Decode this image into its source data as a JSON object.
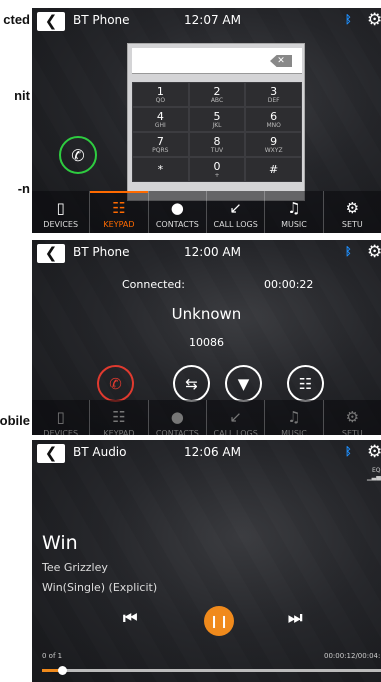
{
  "doc_fragments": [
    "cted",
    "nit",
    "n-",
    "obile"
  ],
  "nav": [
    "DEVICES",
    "KEYPAD",
    "CONTACTS",
    "CALL LOGS",
    "MUSIC",
    "SETU"
  ],
  "nav_icons": [
    "phone-device-icon",
    "keypad-grid-icon",
    "person-icon",
    "call-log-arrow-icon",
    "music-note-icon",
    "gear-icon"
  ],
  "screen1": {
    "title": "BT Phone",
    "time": "12:07 AM",
    "keys": [
      {
        "digit": "1",
        "letters": "QO"
      },
      {
        "digit": "2",
        "letters": "ABC"
      },
      {
        "digit": "3",
        "letters": "DEF"
      },
      {
        "digit": "4",
        "letters": "GHI"
      },
      {
        "digit": "5",
        "letters": "JKL"
      },
      {
        "digit": "6",
        "letters": "MNO"
      },
      {
        "digit": "7",
        "letters": "PQRS"
      },
      {
        "digit": "8",
        "letters": "TUV"
      },
      {
        "digit": "9",
        "letters": "WXYZ"
      },
      {
        "digit": "*",
        "letters": ""
      },
      {
        "digit": "0",
        "letters": "+"
      },
      {
        "digit": "#",
        "letters": ""
      }
    ]
  },
  "screen2": {
    "title": "BT Phone",
    "time": "12:00 AM",
    "status": "Connected:",
    "duration": "00:00:22",
    "caller": "Unknown",
    "number": "10086"
  },
  "screen3": {
    "title": "BT Audio",
    "time": "12:06 AM",
    "eq_label": "EQ",
    "song": "Win",
    "artist": "Tee Grizzley",
    "album": "Win(Single) (Explicit)",
    "track_pos": "0 of 1",
    "elapsed_total": "00:00:12/00:04:",
    "progress_fraction": 0.06
  },
  "colors": {
    "accent": "#ff6a00",
    "bluetooth": "#1e90ff",
    "call_green": "#2ecc40",
    "end_red": "#e03a2f",
    "play_orange": "#f08a1c"
  }
}
